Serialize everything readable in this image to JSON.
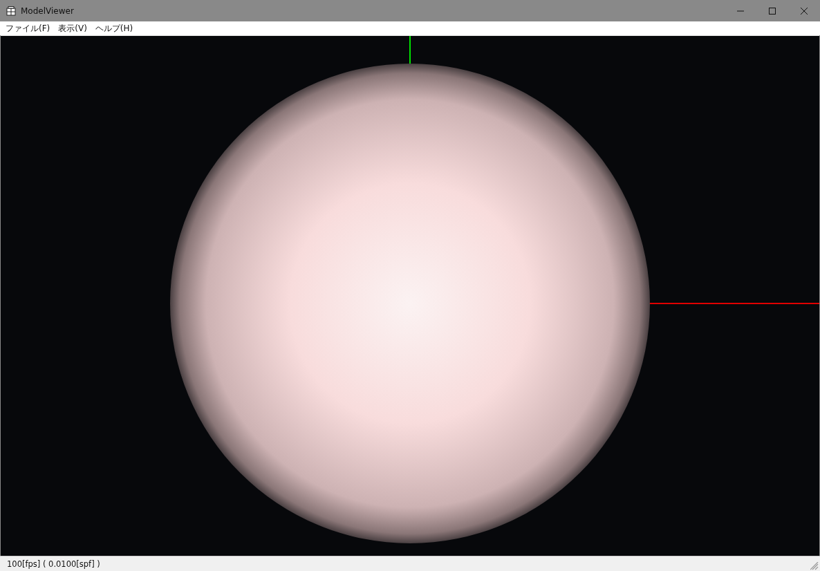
{
  "window": {
    "title": "ModelViewer"
  },
  "menu": [
    {
      "label": "ファイル(F)"
    },
    {
      "label": "表示(V)"
    },
    {
      "label": "ヘルプ(H)"
    }
  ],
  "status_bar": {
    "text": "100[fps] ( 0.0100[spf] )"
  }
}
